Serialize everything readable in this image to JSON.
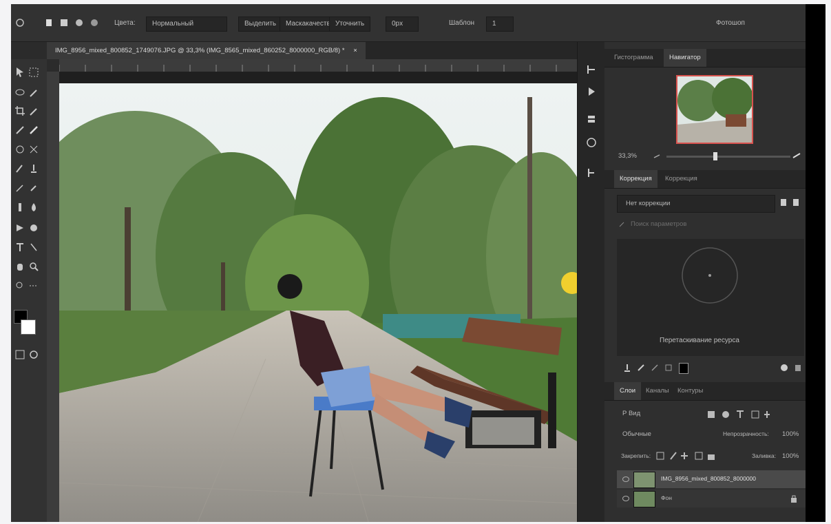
{
  "optionsbar": {
    "field1_label": "Цвета:",
    "field1_value": "Нормальный",
    "btn_select": "Выделить",
    "btn_mask": "Маскакачество",
    "btn_refine": "Уточнить",
    "field_value": "0px",
    "zoom_label": "Шаблон",
    "zoom_value": "1",
    "workspace": "Фотошоп"
  },
  "document": {
    "tab_title": "IMG_8956_mixed_800852_1749076.JPG @ 33,3% (IMG_8565_mixed_860252_8000000_RGB/8) *",
    "tab_close": "×"
  },
  "navigator": {
    "tab_histogram": "Гистограмма",
    "tab_navigator": "Навигатор",
    "zoom_value": "33,3%"
  },
  "adjustments": {
    "tab_adjust": "Коррекция",
    "tab_styles": "Коррекция",
    "dropdown_value": "Нет коррекции",
    "search_placeholder": "Поиск параметров",
    "drag_hint": "Перетаскивание ресурса"
  },
  "layers": {
    "tab_layers": "Слои",
    "tab_channels": "Каналы",
    "tab_paths": "Контуры",
    "filter_label": "Р Вид",
    "blend_mode": "Обычные",
    "opacity_label": "Непрозрачность:",
    "opacity_value": "100%",
    "lock_label": "Закрепить:",
    "fill_label": "Заливка:",
    "fill_value": "100%",
    "items": [
      {
        "name": "IMG_8956_mixed_800852_8000000"
      },
      {
        "name": "Фон"
      }
    ]
  },
  "colors": {
    "accent": "#d9534f"
  }
}
